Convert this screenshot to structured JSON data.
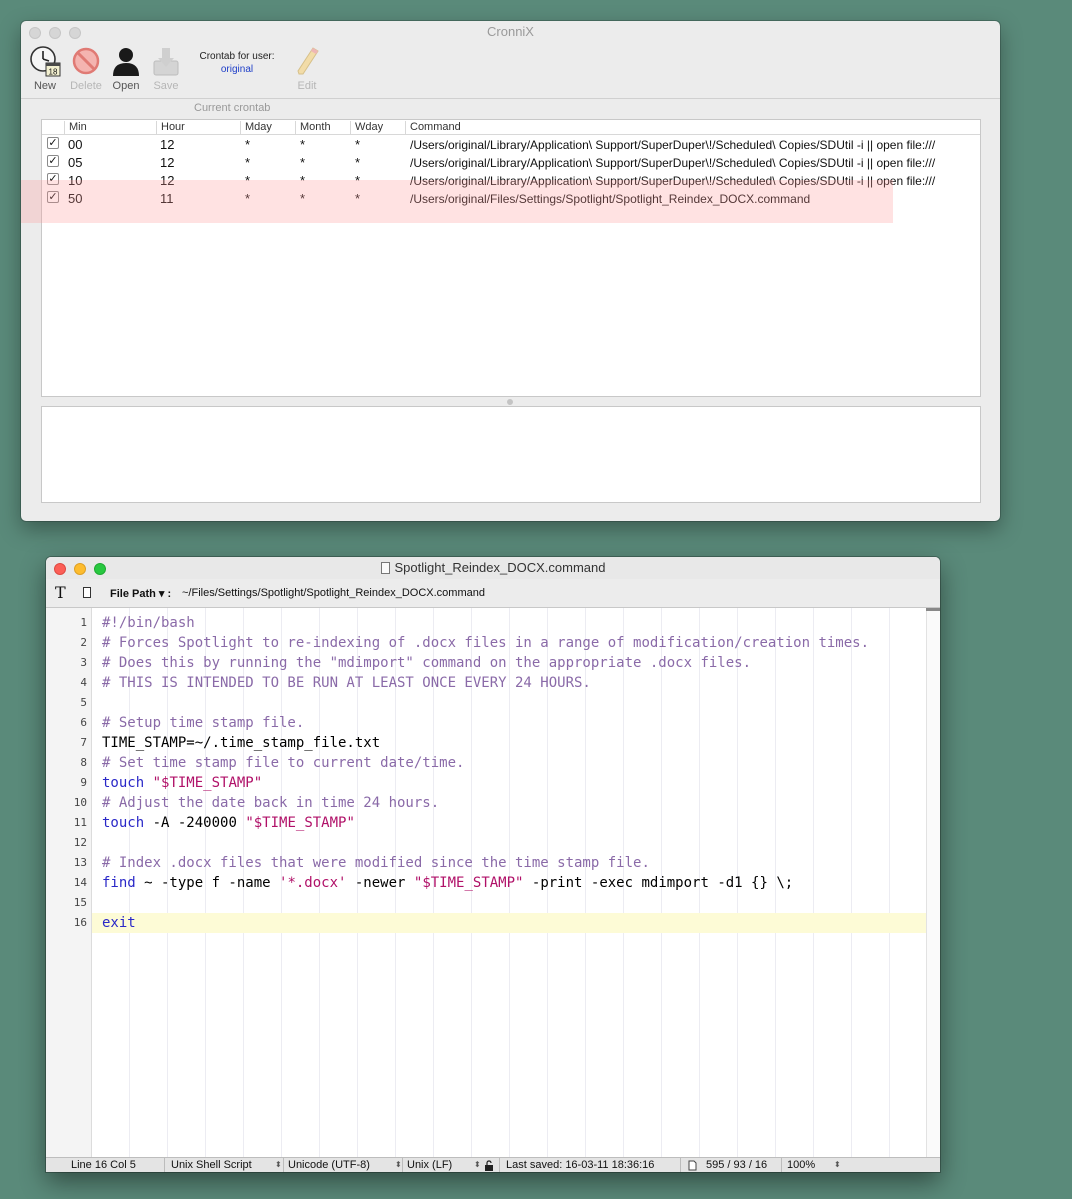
{
  "cronnix": {
    "title": "CronniX",
    "toolbar": {
      "new_label": "New",
      "new_badge": "18",
      "delete_label": "Delete",
      "open_label": "Open",
      "save_label": "Save",
      "crontab_for_user": "Crontab for user:",
      "user_name": "original",
      "current_crontab_label": "Current crontab",
      "edit_label": "Edit"
    },
    "columns": [
      "Min",
      "Hour",
      "Mday",
      "Month",
      "Wday",
      "Command"
    ],
    "rows": [
      {
        "checked": true,
        "min": "00",
        "hour": "12",
        "mday": "*",
        "month": "*",
        "wday": "*",
        "command": "/Users/original/Library/Application\\ Support/SuperDuper\\!/Scheduled\\ Copies/SDUtil -i || open file:///"
      },
      {
        "checked": true,
        "min": "05",
        "hour": "12",
        "mday": "*",
        "month": "*",
        "wday": "*",
        "command": "/Users/original/Library/Application\\ Support/SuperDuper\\!/Scheduled\\ Copies/SDUtil -i || open file:///"
      },
      {
        "checked": true,
        "min": "10",
        "hour": "12",
        "mday": "*",
        "month": "*",
        "wday": "*",
        "command": "/Users/original/Library/Application\\ Support/SuperDuper\\!/Scheduled\\ Copies/SDUtil -i || open file:///"
      },
      {
        "checked": true,
        "min": "50",
        "hour": "11",
        "mday": "*",
        "month": "*",
        "wday": "*",
        "command": "/Users/original/Files/Settings/Spotlight/Spotlight_Reindex_DOCX.command"
      }
    ],
    "checkmark": "✓"
  },
  "editor": {
    "title": "Spotlight_Reindex_DOCX.command",
    "toolbar_t": "T",
    "file_path_label": "File Path ▾ :",
    "file_path_value": "~/Files/Settings/Spotlight/Spotlight_Reindex_DOCX.command",
    "current_line": 16,
    "lines": [
      {
        "n": "1",
        "parts": [
          {
            "c": "comment",
            "t": "#!/bin/bash"
          }
        ]
      },
      {
        "n": "2",
        "parts": [
          {
            "c": "comment",
            "t": "# Forces Spotlight to re-indexing of .docx files in a range of modification/creation times."
          }
        ]
      },
      {
        "n": "3",
        "parts": [
          {
            "c": "comment",
            "t": "# Does this by running the \"mdimport\" command on the appropriate .docx files."
          }
        ]
      },
      {
        "n": "4",
        "parts": [
          {
            "c": "comment",
            "t": "# THIS IS INTENDED TO BE RUN AT LEAST ONCE EVERY 24 HOURS."
          }
        ]
      },
      {
        "n": "5",
        "parts": []
      },
      {
        "n": "6",
        "parts": [
          {
            "c": "comment",
            "t": "# Setup time stamp file."
          }
        ]
      },
      {
        "n": "7",
        "parts": [
          {
            "c": "plain",
            "t": "TIME_STAMP=~/.time_stamp_file.txt"
          }
        ]
      },
      {
        "n": "8",
        "parts": [
          {
            "c": "comment",
            "t": "# Set time stamp file to current date/time."
          }
        ]
      },
      {
        "n": "9",
        "parts": [
          {
            "c": "kw",
            "t": "touch"
          },
          {
            "c": "plain",
            "t": " "
          },
          {
            "c": "str",
            "t": "\"$TIME_STAMP\""
          }
        ]
      },
      {
        "n": "10",
        "parts": [
          {
            "c": "comment",
            "t": "# Adjust the date back in time 24 hours."
          }
        ]
      },
      {
        "n": "11",
        "parts": [
          {
            "c": "kw",
            "t": "touch"
          },
          {
            "c": "plain",
            "t": " -A -240000 "
          },
          {
            "c": "str",
            "t": "\"$TIME_STAMP\""
          }
        ]
      },
      {
        "n": "12",
        "parts": []
      },
      {
        "n": "13",
        "parts": [
          {
            "c": "comment",
            "t": "# Index .docx files that were modified since the time stamp file."
          }
        ]
      },
      {
        "n": "14",
        "parts": [
          {
            "c": "kw",
            "t": "find"
          },
          {
            "c": "plain",
            "t": " ~ -type f -name "
          },
          {
            "c": "str",
            "t": "'*.docx'"
          },
          {
            "c": "plain",
            "t": " -newer "
          },
          {
            "c": "str",
            "t": "\"$TIME_STAMP\""
          },
          {
            "c": "plain",
            "t": " -print -exec mdimport -d1 {} \\;"
          }
        ]
      },
      {
        "n": "15",
        "parts": []
      },
      {
        "n": "16",
        "parts": [
          {
            "c": "kw",
            "t": "exit"
          }
        ]
      }
    ],
    "status": {
      "position": "Line 16 Col 5",
      "language": "Unix Shell Script",
      "encoding": "Unicode (UTF-8)",
      "line_endings": "Unix (LF)",
      "last_saved": "Last saved: 16-03-11 18:36:16",
      "counts": "595 / 93 / 16",
      "zoom": "100%",
      "updown": "⬍"
    }
  },
  "colors": {
    "desktop": "#5a8a7a",
    "comment": "#8a6aa8",
    "keyword": "#2a28c8",
    "string": "#b01068",
    "current_line": "#fdfbd6",
    "selection_highlight": "#ffd6d6"
  }
}
